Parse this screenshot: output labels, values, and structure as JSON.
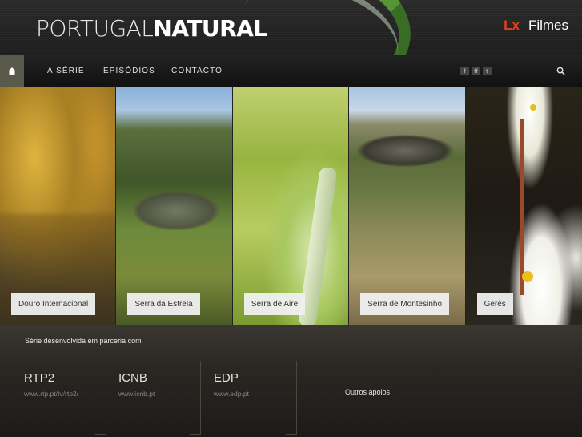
{
  "header": {
    "logo_light": "PORTUGAL",
    "logo_bold": "NATURAL",
    "brand_lx": "Lx",
    "brand_name": "Filmes"
  },
  "nav": {
    "home_icon": "home-icon",
    "items": [
      "A SÉRIE",
      "EPISÓDIOS",
      "CONTACTO"
    ],
    "social": [
      "f",
      "ff",
      "t"
    ],
    "search_icon": "search-icon"
  },
  "gallery": {
    "panels": [
      {
        "label": "Douro Internacional"
      },
      {
        "label": "Serra da Estrela"
      },
      {
        "label": "Serra de Aire"
      },
      {
        "label": "Serra de Montesinho"
      },
      {
        "label": "Gerês"
      }
    ]
  },
  "footer": {
    "partner_title": "Série desenvolvida em parceria com",
    "partners": [
      {
        "name": "RTP2",
        "url": "www.rtp.pt/tv/rtp2/"
      },
      {
        "name": "ICNB",
        "url": "www.icnb.pt"
      },
      {
        "name": "EDP",
        "url": "www.edp.pt"
      }
    ],
    "outros": "Outros apoios"
  },
  "colors": {
    "brand_accent": "#e0401e",
    "home_bg": "#5a5a4a"
  }
}
